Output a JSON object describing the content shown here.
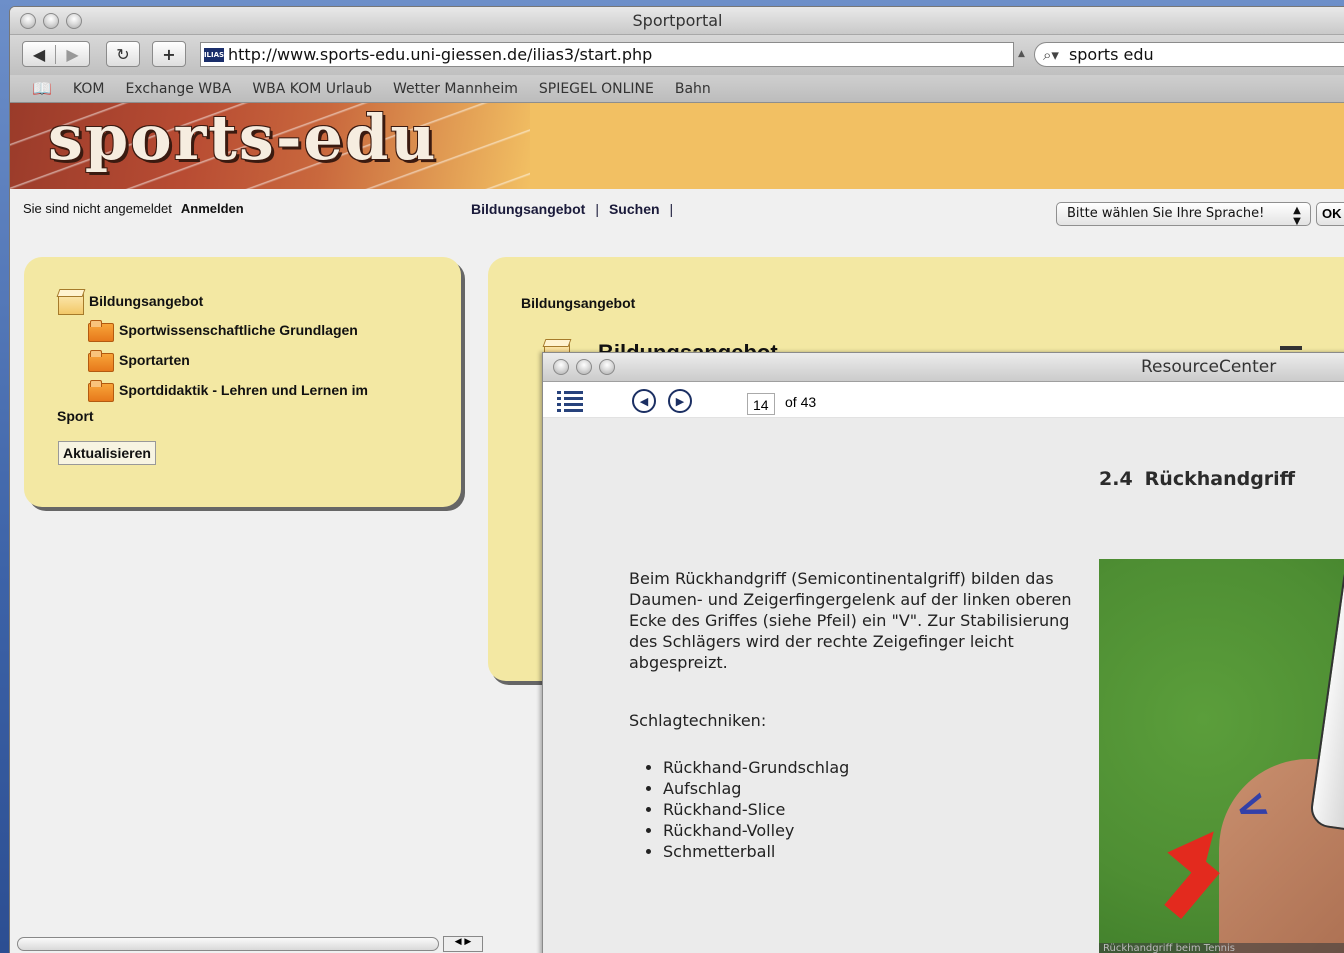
{
  "browser": {
    "window_title": "Sportportal",
    "url": "http://www.sports-edu.uni-giessen.de/ilias3/start.php",
    "favicon_text": "ILIAS",
    "search_value": "sports edu",
    "bookmarks": [
      "KOM",
      "Exchange WBA",
      "WBA KOM Urlaub",
      "Wetter Mannheim",
      "SPIEGEL ONLINE",
      "Bahn"
    ]
  },
  "site": {
    "logo": "sports-edu",
    "not_logged_in": "Sie sind nicht angemeldet",
    "login_link": "Anmelden",
    "nav": [
      "Bildungsangebot",
      "Suchen"
    ],
    "nav_sep": "|",
    "language_select": "Bitte wählen Sie Ihre Sprache!",
    "ok_button": "OK"
  },
  "left_panel": {
    "root": "Bildungsangebot",
    "items": [
      "Sportwissenschaftliche Grundlagen",
      "Sportarten",
      "Sportdidaktik - Lehren und Lernen im",
      "Sport"
    ],
    "update_button": "Aktualisieren"
  },
  "right_panel": {
    "breadcrumb": "Bildungsangebot",
    "title": "Bildungsangebot"
  },
  "resource_center": {
    "window_title": "ResourceCenter",
    "page_current": "14",
    "page_of": "of 43",
    "heading_number": "2.4",
    "heading_text": "Rückhandgriff",
    "paragraph": "Beim Rückhandgriff (Semicontinentalgriff) bilden das Daumen- und Zeigerfingergelenk auf der linken oberen Ecke des Griffes (siehe Pfeil) ein \"V\". Zur Stabilisierung des Schlägers wird der rechte Zeigefinger leicht abgespreizt.",
    "subheading": "Schlagtechniken:",
    "techniques": [
      "Rückhand-Grundschlag",
      "Aufschlag",
      "Rückhand-Slice",
      "Rückhand-Volley",
      "Schmetterball"
    ],
    "image_caption": "Rückhandgriff beim Tennis"
  }
}
